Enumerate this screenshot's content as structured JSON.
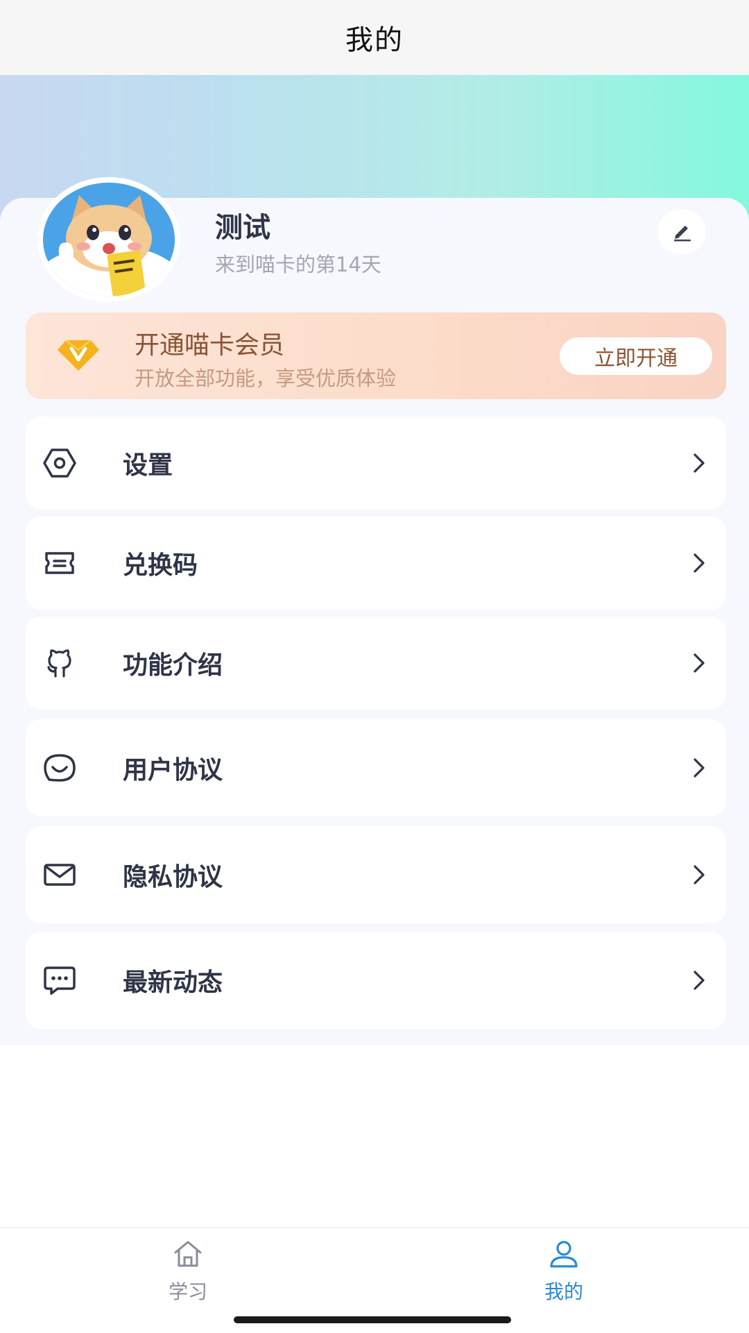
{
  "header": {
    "title": "我的"
  },
  "profile": {
    "name": "测试",
    "days_text": "来到喵卡的第14天"
  },
  "vip": {
    "title": "开通喵卡会员",
    "subtitle": "开放全部功能，享受优质体验",
    "button": "立即开通"
  },
  "menu": [
    {
      "label": "设置",
      "icon": "settings-icon"
    },
    {
      "label": "兑换码",
      "icon": "ticket-icon"
    },
    {
      "label": "功能介绍",
      "icon": "github-icon"
    },
    {
      "label": "用户协议",
      "icon": "smile-chat-icon"
    },
    {
      "label": "隐私协议",
      "icon": "mail-icon"
    },
    {
      "label": "最新动态",
      "icon": "message-dots-icon"
    }
  ],
  "tabbar": {
    "tabs": [
      {
        "label": "学习",
        "icon": "home-icon",
        "active": false
      },
      {
        "label": "我的",
        "icon": "user-icon",
        "active": true
      }
    ]
  },
  "colors": {
    "accent": "#2a8ad4",
    "text_dark": "#2f3447",
    "vip_brown": "#8a5434"
  }
}
